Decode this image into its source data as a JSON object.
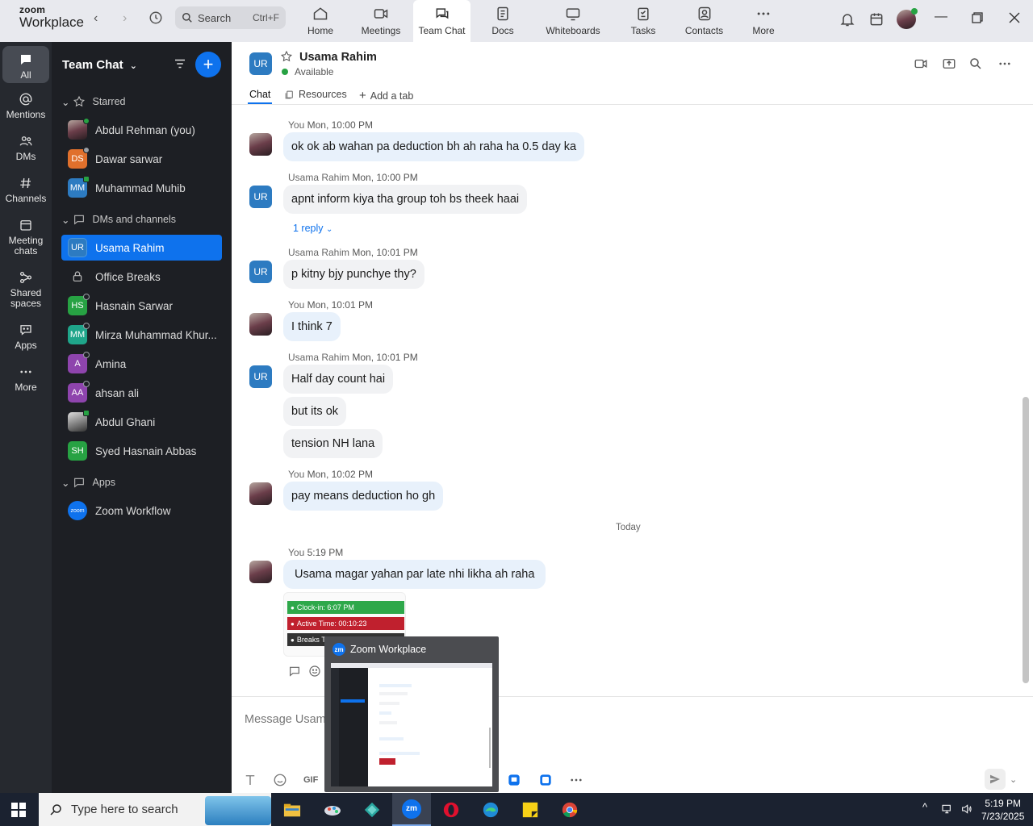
{
  "app": {
    "brand_top": "zoom",
    "brand_bottom": "Workplace"
  },
  "topbar": {
    "search_label": "Search",
    "search_shortcut": "Ctrl+F",
    "tabs": [
      {
        "label": "Home",
        "icon": "home-icon"
      },
      {
        "label": "Meetings",
        "icon": "meetings-icon"
      },
      {
        "label": "Team Chat",
        "icon": "team-chat-icon"
      },
      {
        "label": "Docs",
        "icon": "docs-icon"
      },
      {
        "label": "Whiteboards",
        "icon": "whiteboards-icon"
      },
      {
        "label": "Tasks",
        "icon": "tasks-icon"
      },
      {
        "label": "Contacts",
        "icon": "contacts-icon"
      },
      {
        "label": "More",
        "icon": "more-icon"
      }
    ],
    "active_tab": "Team Chat"
  },
  "rail": {
    "items": [
      {
        "label": "All",
        "icon": "chat-bubble-icon"
      },
      {
        "label": "Mentions",
        "icon": "at-icon"
      },
      {
        "label": "DMs",
        "icon": "people-icon"
      },
      {
        "label": "Channels",
        "icon": "hash-icon"
      },
      {
        "label": "Meeting chats",
        "icon": "calendar-icon"
      },
      {
        "label": "Shared spaces",
        "icon": "shared-spaces-icon"
      },
      {
        "label": "Apps",
        "icon": "apps-icon"
      },
      {
        "label": "More",
        "icon": "more-icon"
      }
    ]
  },
  "sidebar": {
    "title": "Team Chat",
    "sections": {
      "starred": "Starred",
      "dms": "DMs and channels",
      "apps": "Apps"
    },
    "starred": [
      {
        "name": "Abdul Rehman (you)",
        "initials": "",
        "color": "#6b3e4a",
        "status": "#27a243"
      },
      {
        "name": "Dawar sarwar",
        "initials": "DS",
        "color": "#e0702c",
        "status": "#9aa0a6"
      },
      {
        "name": "Muhammad Muhib",
        "initials": "MM",
        "color": "#2d7bc1",
        "status": "#27a243"
      }
    ],
    "dms": [
      {
        "name": "Usama Rahim",
        "initials": "UR",
        "color": "#2d7bc1",
        "status": "",
        "active": true
      },
      {
        "name": "Office Breaks",
        "initials": "",
        "color": "",
        "status": "",
        "lock": true
      },
      {
        "name": "Hasnain Sarwar",
        "initials": "HS",
        "color": "#27a243",
        "status": "#9aa0a6"
      },
      {
        "name": "Mirza Muhammad Khur...",
        "initials": "MM",
        "color": "#1fa58a",
        "status": "#9aa0a6"
      },
      {
        "name": "Amina",
        "initials": "A",
        "color": "#8e44ad",
        "status": "#9aa0a6"
      },
      {
        "name": "ahsan ali",
        "initials": "AA",
        "color": "#8e44ad",
        "status": "#9aa0a6"
      },
      {
        "name": "Abdul Ghani",
        "initials": "",
        "color": "#555",
        "status": "#27a243"
      },
      {
        "name": "Syed Hasnain Abbas",
        "initials": "SH",
        "color": "#27a243",
        "status": ""
      }
    ],
    "apps": [
      {
        "name": "Zoom Workflow",
        "initials": "zoom",
        "color": "#0e72ed"
      }
    ]
  },
  "chat": {
    "contact_initials": "UR",
    "contact_name": "Usama Rahim",
    "status": "Available",
    "tabs": [
      "Chat",
      "Resources",
      "Add a tab"
    ],
    "messages": [
      {
        "sender": "You",
        "time": "Mon, 10:00 PM",
        "lines": [
          "ok ok ab wahan pa deduction bh ah raha ha 0.5 day ka"
        ]
      },
      {
        "sender": "Usama Rahim",
        "time": "Mon, 10:00 PM",
        "lines": [
          "apnt inform kiya tha group toh bs theek haai"
        ],
        "reply": "1 reply"
      },
      {
        "sender": "Usama Rahim",
        "time": "Mon, 10:01 PM",
        "lines": [
          "p kitny bjy punchye thy?"
        ]
      },
      {
        "sender": "You",
        "time": "Mon, 10:01 PM",
        "lines": [
          "I think 7"
        ]
      },
      {
        "sender": "Usama Rahim",
        "time": "Mon, 10:01 PM",
        "lines": [
          "Half day count hai",
          "but its ok",
          "tension NH lana"
        ]
      },
      {
        "sender": "You",
        "time": "Mon, 10:02 PM",
        "lines": [
          "pay means deduction ho gh"
        ]
      },
      {
        "sender": "You",
        "time": "5:19 PM",
        "lines": [
          "Usama magar yahan par late nhi likha ah raha"
        ]
      }
    ],
    "day_separator": "Today",
    "attachment_rows": [
      {
        "text": "Clock-in: 6:07 PM",
        "color": "#2ea84a"
      },
      {
        "text": "Active Time: 00:10:23",
        "color": "#c0202e"
      },
      {
        "text": "Breaks T",
        "color": "#333333"
      }
    ],
    "compose_placeholder": "Message Usam",
    "gif_label": "GIF"
  },
  "popup": {
    "title": "Zoom Workplace",
    "logo": "zm"
  },
  "taskbar": {
    "search_placeholder": "Type here to search",
    "time": "5:19 PM",
    "date": "7/23/2025"
  }
}
